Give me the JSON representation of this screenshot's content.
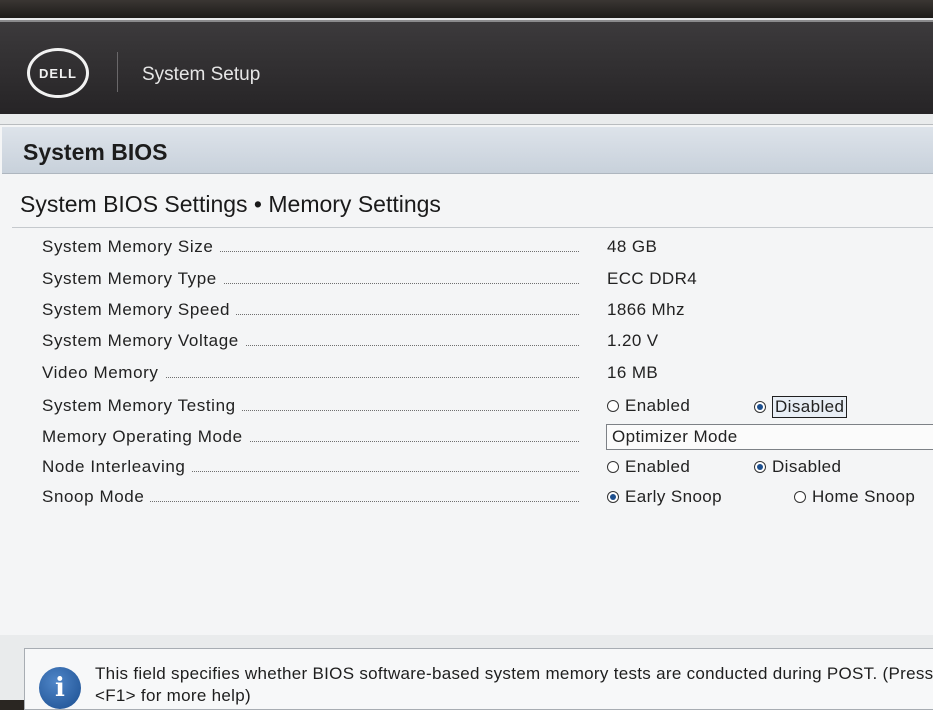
{
  "header": {
    "logo_text": "DELL",
    "title": "System Setup"
  },
  "panel": {
    "title": "System BIOS",
    "subtitle": "System BIOS Settings • Memory Settings"
  },
  "settings": {
    "memory_size": {
      "label": "System Memory Size",
      "value": "48 GB"
    },
    "memory_type": {
      "label": "System Memory Type",
      "value": "ECC DDR4"
    },
    "memory_speed": {
      "label": "System Memory Speed",
      "value": "1866 Mhz"
    },
    "memory_voltage": {
      "label": "System Memory Voltage",
      "value": "1.20 V"
    },
    "video_memory": {
      "label": "Video Memory",
      "value": "16 MB"
    },
    "memory_testing": {
      "label": "System Memory Testing",
      "options": [
        "Enabled",
        "Disabled"
      ],
      "selected": "Disabled"
    },
    "operating_mode": {
      "label": "Memory Operating Mode",
      "selected": "Optimizer Mode"
    },
    "node_interleaving": {
      "label": "Node Interleaving",
      "options": [
        "Enabled",
        "Disabled"
      ],
      "selected": "Disabled"
    },
    "snoop_mode": {
      "label": "Snoop Mode",
      "options": [
        "Early Snoop",
        "Home Snoop"
      ],
      "selected": "Early Snoop"
    }
  },
  "help": {
    "icon": "info-icon",
    "icon_glyph": "i",
    "text": "This field specifies whether BIOS software-based system memory tests are conducted during POST. (Press <F1> for more help)"
  },
  "colors": {
    "header_bg": "#2f2d2f",
    "title_bar": "#d3dae2",
    "radio_selected": "#1d4f8e"
  }
}
